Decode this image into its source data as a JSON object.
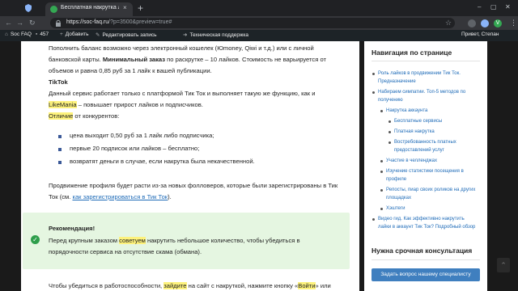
{
  "browser": {
    "tab_title": "Бесплатная накрутка лайков",
    "tab_close": "×",
    "new_tab": "+",
    "url_main": "https://soc-faq.ru",
    "url_rest": "/?p=3500&preview=true#",
    "profile_letter": "V",
    "win_min": "–",
    "win_max": "▢",
    "win_close": "✕"
  },
  "admin_bar": {
    "site": "Soc FAQ",
    "comments": "457",
    "add": "Добавить",
    "edit": "Редактировать запись",
    "support": "Техническая поддержка",
    "greeting": "Привет, Степан"
  },
  "article": {
    "p1_l1": "Пополнить баланс возможно через электронный кошелек (Юmoney, Qiwi и т.д.) или с личной",
    "p1_l2_a": "банковской карты. ",
    "p1_l2_b": "Минимальный заказ",
    "p1_l2_c": " по раскрутке – 10 лайков. Стоимость не варьируется от",
    "p1_l3": "объемов и равна 0,85 руб за 1 лайк к вашей публикации.",
    "tiktok_label": "TikTok",
    "p2_l1": "Данный сервис работает только с платформой Тик Ток и выполняет такую же функцию, как и",
    "p2_l2_hl": "LikeMania",
    "p2_l2_rest": " – повышает прирост лайков и подписчиков.",
    "p2_l3_hl": "Отличие",
    "p2_l3_rest": " от конкурентов:",
    "bullets": [
      "цена выходит 0,50 руб за 1 лайк либо подписчика;",
      "первые 20 подписок или лайков – бесплатно;",
      "возвратят деньги в случае, если накрутка была некачественной."
    ],
    "p3_l1": "Продвижение профиля будет расти из-за новых фолловеров, которые были зарегистрированы в Тик",
    "p3_l2_a": "Ток (см. ",
    "p3_l2_link": "как зарегистрироваться в Тик Ток",
    "p3_l2_c": ").",
    "rec_title": "Рекомендация!",
    "rec_l1_a": "Перед крупным заказом ",
    "rec_l1_hl": "советуем",
    "rec_l1_c": " накрутить небольшое количество, чтобы убедиться в",
    "rec_l2": "порядочности сервиса на отсутствие скама (обмана).",
    "p4_a": "Чтобы убедиться в работоспособности, ",
    "p4_hl": "зайдите",
    "p4_b": " на сайт с накруткой, нажмите кнопку «",
    "p4_hl2": "Войти",
    "p4_c": "» или"
  },
  "sidebar": {
    "toc_title": "Навигация по странице",
    "toc": [
      "Роль лайков в продвижении Тик Ток.",
      "Предназначение",
      "Набираем симпатии. Топ-5 методов по",
      "получению",
      "Накрутка аккаунта",
      "Бесплатные сервисы",
      "Платная накрутка",
      "Востребованность платных",
      "предоставлений услуг",
      "Участие в челленджах",
      "Изучение статистики посещения в",
      "профиле",
      "Репосты, пиар своих роликов на других",
      "площадках",
      "Хэштеги",
      "Видео гид. Как эффективно накрутить",
      "лайки в аккаунт Тик Ток? Подробный обзор"
    ],
    "consult_title": "Нужна срочная консультация",
    "consult_button": "Задать вопрос нашему специалисту"
  },
  "colors": {
    "highlight": "#fdf27c",
    "link": "#1e6bb8",
    "rec_bg": "#e5f6e1",
    "rec_icon": "#2e9e4b",
    "button": "#3f7fbf"
  }
}
